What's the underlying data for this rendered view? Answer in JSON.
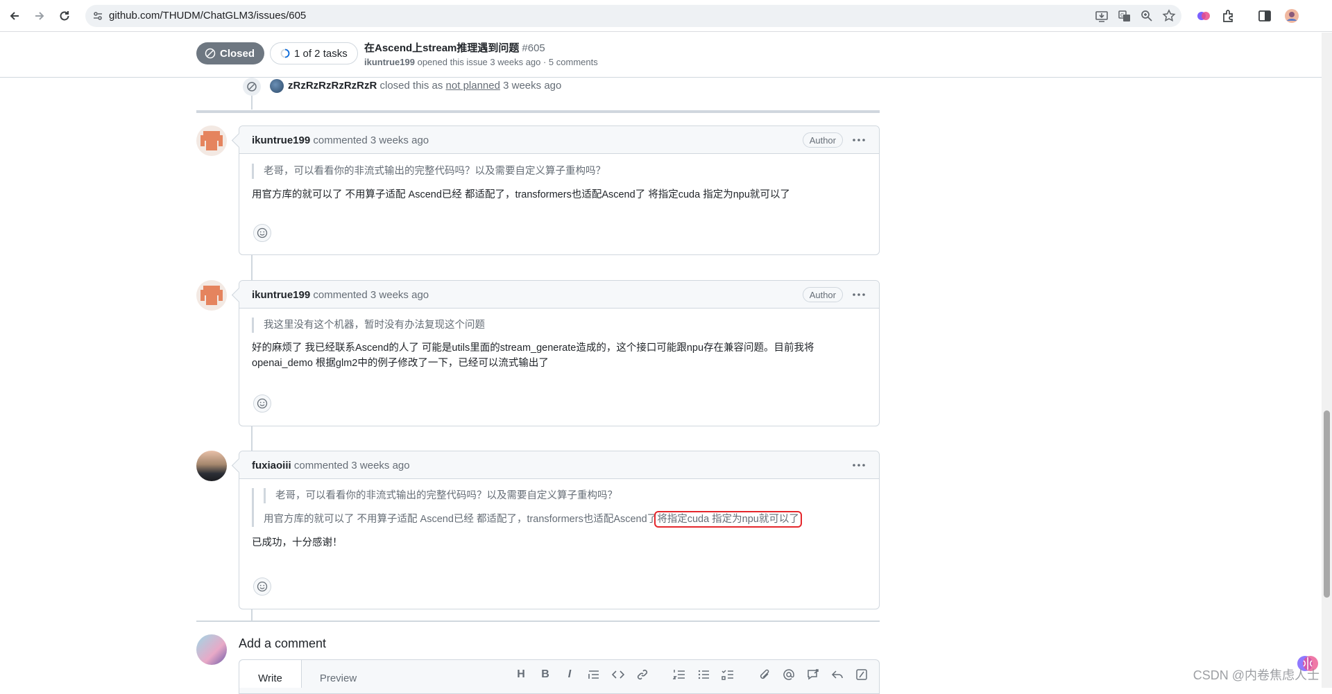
{
  "browser": {
    "url": "github.com/THUDM/ChatGLM3/issues/605"
  },
  "issue": {
    "state": "Closed",
    "tasks": "1 of 2 tasks",
    "title": "在Ascend上stream推理遇到问题",
    "number": "#605",
    "meta_author": "ikuntrue199",
    "meta_text": " opened this issue 3 weeks ago · 5 comments"
  },
  "closed_event": {
    "actor": "zRzRzRzRzRzRzR",
    "text_pre": " closed this as ",
    "reason": "not planned",
    "time": " 3 weeks ago"
  },
  "comments": [
    {
      "author": "ikuntrue199",
      "action": " commented 3 weeks ago",
      "badge": "Author",
      "quote": "老哥，可以看看你的非流式输出的完整代码吗？以及需要自定义算子重构吗？",
      "body": "用官方库的就可以了 不用算子适配 Ascend已经 都适配了，transformers也适配Ascend了 将指定cuda 指定为npu就可以了"
    },
    {
      "author": "ikuntrue199",
      "action": " commented 3 weeks ago",
      "badge": "Author",
      "quote": "我这里没有这个机器，暂时没有办法复现这个问题",
      "body_line1": "好的麻烦了 我已经联系Ascend的人了 可能是utils里面的stream_generate造成的，这个接口可能跟npu存在兼容问题。目前我将",
      "body_line2": "openai_demo 根据glm2中的例子修改了一下，已经可以流式输出了"
    },
    {
      "author": "fuxiaoiii",
      "action": " commented 3 weeks ago",
      "quote_nested": "老哥，可以看看你的非流式输出的完整代码吗？以及需要自定义算子重构吗？",
      "quote_part1": "用官方库的就可以了 不用算子适配 Ascend已经 都适配了，transformers也适配Ascend了",
      "quote_highlight": "将指定cuda 指定为npu就可以了",
      "body": "已成功，十分感谢！"
    }
  ],
  "add_comment": {
    "title": "Add a comment",
    "tab_write": "Write",
    "tab_preview": "Preview",
    "format_heading": "H",
    "format_bold": "B",
    "format_italic": "I"
  },
  "watermark": "CSDN @内卷焦虑人士"
}
